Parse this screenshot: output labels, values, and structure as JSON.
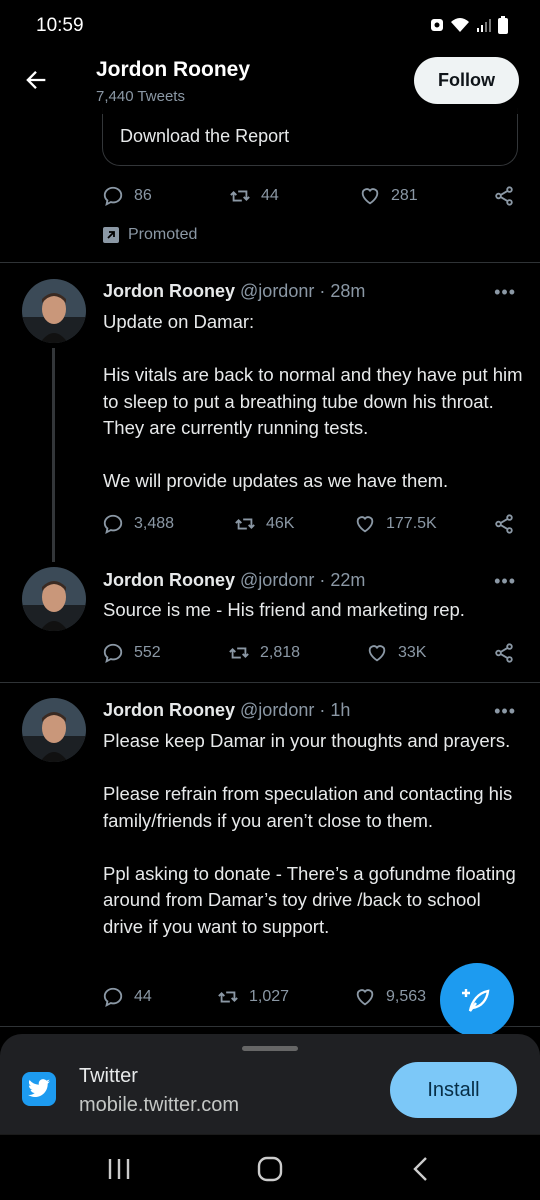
{
  "status_bar": {
    "time": "10:59"
  },
  "header": {
    "name": "Jordon Rooney",
    "tweet_count": "7,440 Tweets",
    "follow_label": "Follow"
  },
  "promo": {
    "card_text": "Download the Report",
    "replies": "86",
    "retweets": "44",
    "likes": "281",
    "promoted_label": "Promoted"
  },
  "tweets": [
    {
      "display_name": "Jordon Rooney",
      "handle": "@jordonr · 28m",
      "text": "Update on Damar:\n\nHis vitals are back to normal and they have put him to sleep to put a breathing tube down his throat. They are currently running tests.\n\nWe will provide updates as we have them.",
      "replies": "3,488",
      "retweets": "46K",
      "likes": "177.5K"
    },
    {
      "display_name": "Jordon Rooney",
      "handle": "@jordonr · 22m",
      "text": "Source is me - His friend and marketing rep.",
      "replies": "552",
      "retweets": "2,818",
      "likes": "33K"
    },
    {
      "display_name": "Jordon Rooney",
      "handle": "@jordonr · 1h",
      "text": "Please keep Damar in your thoughts and prayers.\n\nPlease refrain from speculation and contacting his family/friends if you aren’t close to them.\n\nPpl asking to donate - There’s a gofundme floating around from Damar’s toy drive /back to school drive if you want to support.",
      "replies": "44",
      "retweets": "1,027",
      "likes": "9,563"
    }
  ],
  "app_banner": {
    "app_name": "Twitter",
    "url": "mobile.twitter.com",
    "install_label": "Install"
  },
  "colors": {
    "accent": "#1d9bf0",
    "background": "#000000",
    "secondary_text": "#8b98a5",
    "install_button": "#7cc8f8"
  },
  "icons": [
    "back-arrow-icon",
    "reply-icon",
    "retweet-icon",
    "like-icon",
    "share-icon",
    "more-icon",
    "compose-icon",
    "twitter-bird-icon",
    "recents-icon",
    "home-icon",
    "back-icon"
  ]
}
